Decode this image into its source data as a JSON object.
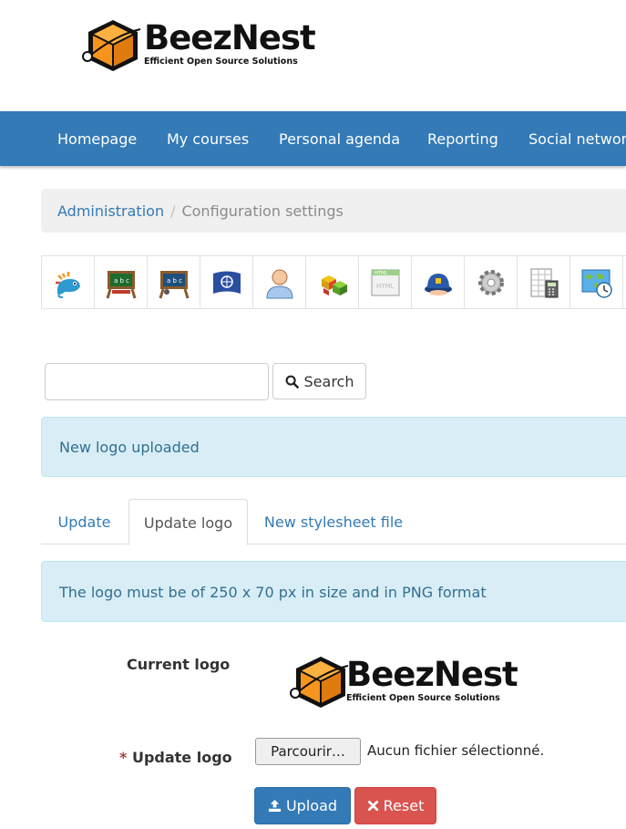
{
  "header": {
    "logo_text": "BeezNest",
    "logo_tagline": "Efficient Open Source Solutions"
  },
  "navbar": {
    "items": [
      {
        "label": "Homepage"
      },
      {
        "label": "My courses"
      },
      {
        "label": "Personal agenda"
      },
      {
        "label": "Reporting"
      },
      {
        "label": "Social network"
      }
    ]
  },
  "breadcrumb": {
    "link": "Administration",
    "separator": "/",
    "current": "Configuration settings"
  },
  "toolbar_icons": [
    "chamilo-chameleon-icon",
    "course-board-icon",
    "session-board-icon",
    "language-flag-icon",
    "user-icon",
    "plugins-blocks-icon",
    "html-editor-icon",
    "security-cap-icon",
    "settings-gear-icon",
    "spreadsheet-calculator-icon",
    "world-map-clock-icon"
  ],
  "search": {
    "input_value": "",
    "button_label": "Search"
  },
  "alerts": {
    "uploaded": "New logo uploaded",
    "logo_hint": "The logo must be of 250 x 70 px in size and in PNG format"
  },
  "tabs": [
    {
      "label": "Update",
      "active": false
    },
    {
      "label": "Update logo",
      "active": true
    },
    {
      "label": "New stylesheet file",
      "active": false
    }
  ],
  "form": {
    "current_logo_label": "Current logo",
    "current_logo_text": "BeezNest",
    "current_logo_tagline": "Efficient Open Source Solutions",
    "required_mark": "*",
    "update_logo_label": "Update logo",
    "file_button_label": "Parcourir…",
    "file_status": "Aucun fichier sélectionné.",
    "upload_label": "Upload",
    "reset_label": "Reset"
  },
  "colors": {
    "primary": "#337ab7",
    "danger": "#d9534f",
    "info_bg": "#d9edf7",
    "info_text": "#31708f",
    "logo_orange": "#f7941d"
  }
}
